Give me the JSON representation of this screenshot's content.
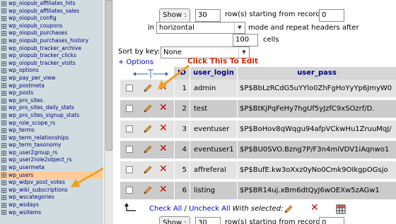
{
  "sidebar": {
    "items": [
      {
        "label": "wp_oiopub_affiliates_hits"
      },
      {
        "label": "wp_oiopub_affiliates_sales"
      },
      {
        "label": "wp_oiopub_config"
      },
      {
        "label": "wp_oiopub_coupons"
      },
      {
        "label": "wp_oiopub_purchases"
      },
      {
        "label": "wp_oiopub_purchases_history"
      },
      {
        "label": "wp_oiopub_tracker_archive"
      },
      {
        "label": "wp_oiopub_tracker_clicks"
      },
      {
        "label": "wp_oiopub_tracker_visits"
      },
      {
        "label": "wp_options"
      },
      {
        "label": "wp_pay_per_view"
      },
      {
        "label": "wp_postmeta"
      },
      {
        "label": "wp_posts"
      },
      {
        "label": "wp_pro_sites"
      },
      {
        "label": "wp_pro_sites_daily_stats"
      },
      {
        "label": "wp_pro_sites_signup_stats"
      },
      {
        "label": "wp_role_scope_rs"
      },
      {
        "label": "wp_terms"
      },
      {
        "label": "wp_term_relationships"
      },
      {
        "label": "wp_term_taxonomy"
      },
      {
        "label": "wp_user2group_rs"
      },
      {
        "label": "wp_user2role2object_rs"
      },
      {
        "label": "wp_usermeta"
      },
      {
        "label": "wp_users",
        "active": true
      },
      {
        "label": "wp_wdpv_post_votes"
      },
      {
        "label": "wp_wiki_subscriptions"
      },
      {
        "label": "wp_wscategories"
      },
      {
        "label": "wp_wsdays"
      },
      {
        "label": "wp_wsitems"
      }
    ]
  },
  "controls": {
    "show_label": "Show :",
    "rows_value": "30",
    "rows_text": "row(s) starting from record #",
    "start_value": "0",
    "in_label": "in",
    "mode_value": "horizontal",
    "mode_text": "mode and repeat headers after",
    "repeat_value": "100",
    "cells_text": "cells",
    "sort_label": "Sort by key:",
    "sort_value": "None",
    "options_link": "+ Options"
  },
  "annotation": "Click This To Edit",
  "table": {
    "headers": {
      "id": "ID",
      "user_login": "user_login",
      "user_pass": "user_pass"
    },
    "rows": [
      {
        "id": "1",
        "user_login": "admin",
        "user_pass": "$P$BbLzRCdG5uYYlo0ZhFgHoYyYp6JmyW0"
      },
      {
        "id": "2",
        "user_login": "test",
        "user_pass": "$P$BtKjPqFeHy7hgUf5yJzfC9xSOzrf/D."
      },
      {
        "id": "3",
        "user_login": "eventuser",
        "user_pass": "$P$BoHov8qWqgu94afpVCkwHu1ZruuMqJ/"
      },
      {
        "id": "4",
        "user_login": "eventuser1",
        "user_pass": "$P$BU0SVO.Bzng7P/F3n4miVDV1iAqnwo1"
      },
      {
        "id": "5",
        "user_login": "affreferal",
        "user_pass": "$P$BufE.kw3oXxz0yNo0Cmk9OIkgpOGsjo"
      },
      {
        "id": "6",
        "user_login": "listing",
        "user_pass": "$P$BR14uj.xBm6dtQyJ6wOEXw5zAGw1"
      }
    ]
  },
  "footer": {
    "check_all": "Check All",
    "separator": "/",
    "uncheck_all": "Uncheck All",
    "with_selected": "With selected:",
    "show_label": "Show :",
    "rows_value": "30",
    "rows_text": "row(s) starting from record #",
    "start_value": "0"
  },
  "colors": {
    "sidebar_bg": "#d0dce0",
    "active_row": "#ffcc99",
    "annotation": "#dd2200",
    "arrow": "#f0a020",
    "header_text": "#000088"
  }
}
